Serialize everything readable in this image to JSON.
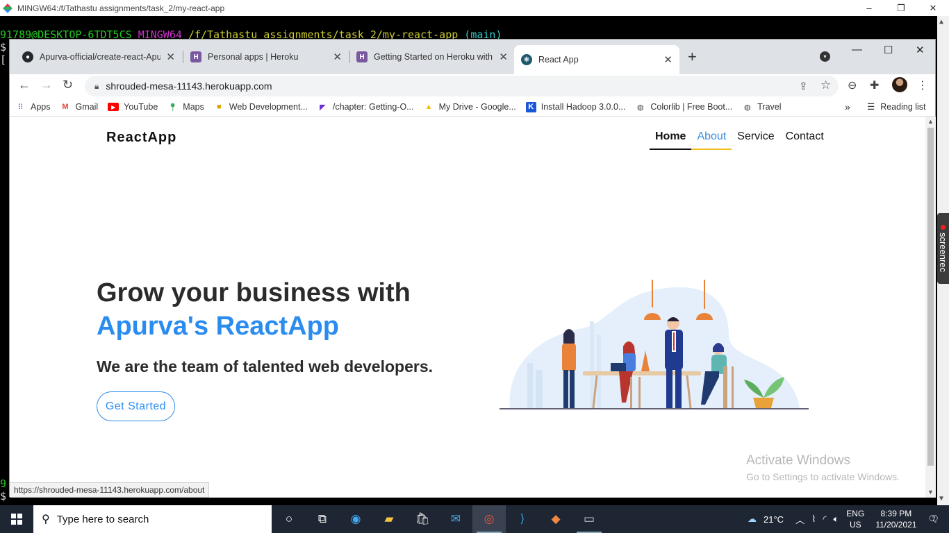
{
  "mingw": {
    "title": "MINGW64:/f/Tathastu assignments/task_2/my-react-app",
    "controls": [
      "–",
      "❐",
      "✕"
    ],
    "prompt_user": "91789@DESKTOP-6TDT5CS",
    "prompt_env": "MINGW64",
    "prompt_path": "/f/Tathastu assignments/task_2/my-react-app",
    "prompt_branch": "(main)",
    "side_glyphs": [
      "$",
      "[",
      "9",
      "$"
    ]
  },
  "chrome": {
    "tabs": [
      {
        "title": "Apurva-official/create-react-Apurva",
        "favicon": "github-icon",
        "color": "#24292e"
      },
      {
        "title": "Personal apps | Heroku",
        "favicon": "heroku-icon",
        "color": "#79589f"
      },
      {
        "title": "Getting Started on Heroku with Node",
        "favicon": "heroku-icon",
        "color": "#79589f"
      },
      {
        "title": "React App",
        "favicon": "react-icon",
        "color": "#1e5a6e"
      }
    ],
    "tab_close": "✕",
    "new_tab": "+",
    "url": "shrouded-mesa-11143.herokuapp.com",
    "bookmarks": [
      {
        "label": "Apps",
        "icon": "apps-grid-icon",
        "color": "#4285f4"
      },
      {
        "label": "Gmail",
        "icon": "gmail-icon",
        "color": "#ea4335"
      },
      {
        "label": "YouTube",
        "icon": "youtube-icon",
        "color": "#ff0000"
      },
      {
        "label": "Maps",
        "icon": "maps-icon",
        "color": "#34a853"
      },
      {
        "label": "Web Development...",
        "icon": "bookmark-icon",
        "color": "#e0a000"
      },
      {
        "label": "/chapter: Getting-O...",
        "icon": "bookmark-icon",
        "color": "#6a2bd8"
      },
      {
        "label": "My Drive - Google...",
        "icon": "drive-icon",
        "color": "#fbbc04"
      },
      {
        "label": "Install Hadoop 3.0.0...",
        "icon": "k-icon",
        "color": "#1a56d8"
      },
      {
        "label": "Colorlib | Free Boot...",
        "icon": "globe-icon",
        "color": "#444444"
      },
      {
        "label": "Travel",
        "icon": "globe-icon",
        "color": "#444444"
      }
    ],
    "more_bookmarks": "»",
    "reading_list": "Reading list",
    "status_url": "https://shrouded-mesa-11143.herokuapp.com/about"
  },
  "site": {
    "brand": "ReactApp",
    "nav": [
      "Home",
      "About",
      "Service",
      "Contact"
    ],
    "hero_line1": "Grow your business with",
    "hero_line2": "Apurva's ReactApp",
    "subtitle": "We are the team of talented web developers.",
    "cta": "Get Started",
    "accent_color": "#2b8cf0"
  },
  "watermark": {
    "line1": "Activate Windows",
    "line2": "Go to Settings to activate Windows."
  },
  "screenrec": "screenrec",
  "taskbar": {
    "search_placeholder": "Type here to search",
    "weather": "21°C",
    "lang1": "ENG",
    "lang2": "US",
    "time": "8:39 PM",
    "date": "11/20/2021",
    "notifications": "7"
  }
}
